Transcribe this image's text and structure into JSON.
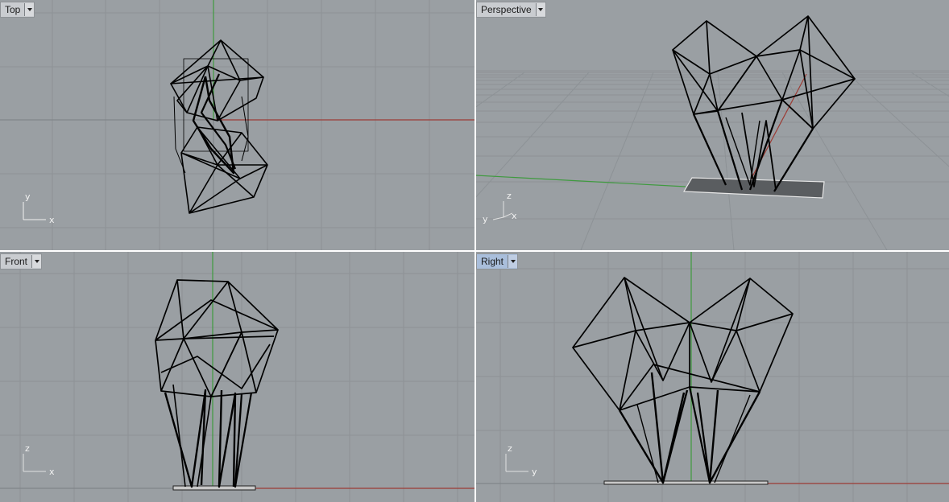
{
  "viewports": {
    "top": {
      "title": "Top",
      "axis_h": "x",
      "axis_v": "y"
    },
    "perspective": {
      "title": "Perspective",
      "axis_h": "x",
      "axis_v": "z",
      "axis_d": "y"
    },
    "front": {
      "title": "Front",
      "axis_h": "x",
      "axis_v": "z"
    },
    "right": {
      "title": "Right",
      "axis_h": "y",
      "axis_v": "z",
      "active": true
    }
  },
  "colors": {
    "viewport_bg": "#9a9fa3",
    "grid_line": "#8d9296",
    "x_axis": "#9c3b34",
    "y_axis": "#3f9a3f",
    "wireframe": "#000000",
    "active_title": "#a9bedb"
  },
  "icons": [
    "dropdown-caret-icon",
    "axis-triad-icon"
  ]
}
